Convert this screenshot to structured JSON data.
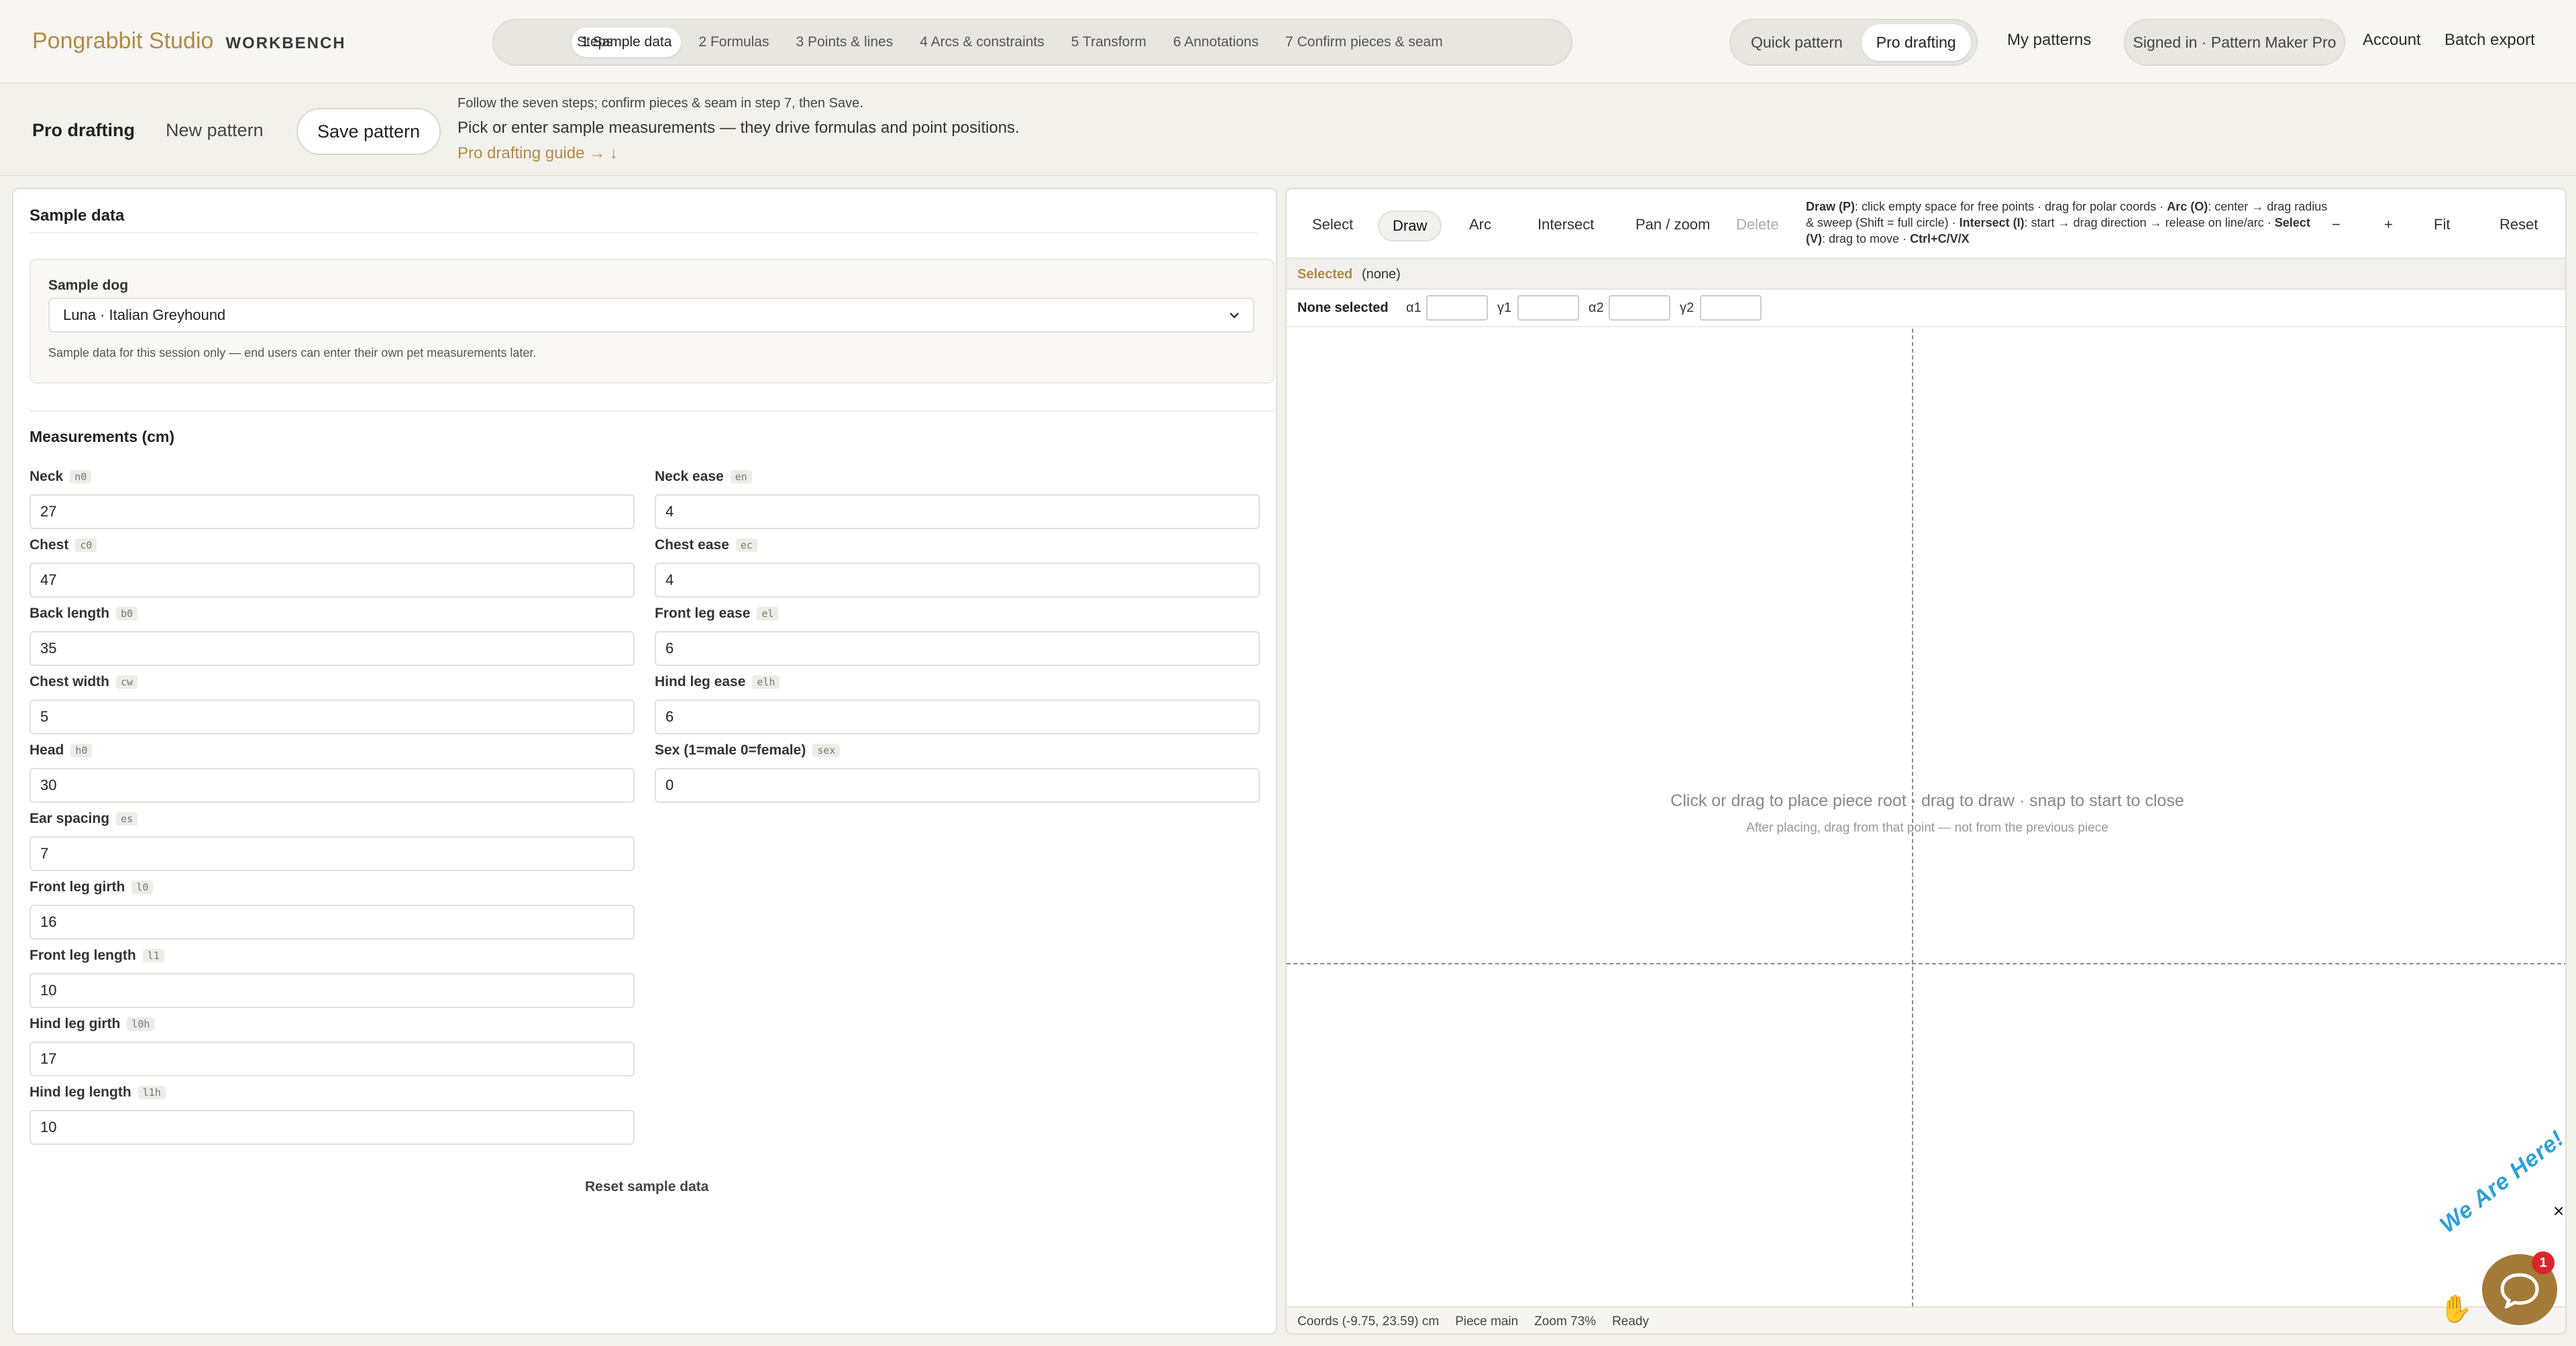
{
  "brand": {
    "name": "Pongrabbit Studio",
    "subtitle": "WORKBENCH"
  },
  "steps": {
    "label": "Steps",
    "items": [
      {
        "label": "1 Sample data",
        "active": true
      },
      {
        "label": "2 Formulas"
      },
      {
        "label": "3 Points & lines"
      },
      {
        "label": "4 Arcs & constraints"
      },
      {
        "label": "5 Transform"
      },
      {
        "label": "6 Annotations"
      },
      {
        "label": "7 Confirm pieces & seam"
      }
    ]
  },
  "mode": {
    "quick": "Quick pattern",
    "pro": "Pro drafting"
  },
  "top_links": {
    "my_patterns": "My patterns",
    "signed_in": "Signed in · Pattern Maker Pro",
    "account": "Account",
    "batch_export": "Batch export"
  },
  "subbar": {
    "pro_drafting": "Pro drafting",
    "new_pattern": "New pattern",
    "save_pattern": "Save pattern",
    "hint_line1": "Follow the seven steps; confirm pieces & seam in step 7, then Save.",
    "hint_line2": "Pick or enter sample measurements — they drive formulas and point positions.",
    "guide_link": "Pro drafting guide → ↓"
  },
  "sample_panel": {
    "title": "Sample data",
    "dog_label": "Sample dog",
    "dog_value": "Luna · Italian Greyhound",
    "dog_note": "Sample data for this session only — end users can enter their own pet measurements later.",
    "measurements_title": "Measurements (cm)",
    "left_fields": [
      {
        "label": "Neck",
        "abbr": "n0",
        "value": "27"
      },
      {
        "label": "Chest",
        "abbr": "c0",
        "value": "47"
      },
      {
        "label": "Back length",
        "abbr": "b0",
        "value": "35"
      },
      {
        "label": "Chest width",
        "abbr": "cw",
        "value": "5"
      },
      {
        "label": "Head",
        "abbr": "h0",
        "value": "30"
      },
      {
        "label": "Ear spacing",
        "abbr": "es",
        "value": "7"
      },
      {
        "label": "Front leg girth",
        "abbr": "l0",
        "value": "16"
      },
      {
        "label": "Front leg length",
        "abbr": "l1",
        "value": "10"
      },
      {
        "label": "Hind leg girth",
        "abbr": "l0h",
        "value": "17"
      },
      {
        "label": "Hind leg length",
        "abbr": "l1h",
        "value": "10"
      }
    ],
    "right_fields": [
      {
        "label": "Neck ease",
        "abbr": "en",
        "value": "4"
      },
      {
        "label": "Chest ease",
        "abbr": "ec",
        "value": "4"
      },
      {
        "label": "Front leg ease",
        "abbr": "el",
        "value": "6"
      },
      {
        "label": "Hind leg ease",
        "abbr": "elh",
        "value": "6"
      },
      {
        "label": "Sex (1=male 0=female)",
        "abbr": "sex",
        "value": "0"
      }
    ],
    "reset": "Reset sample data"
  },
  "tools": {
    "select": "Select",
    "draw": "Draw",
    "arc": "Arc",
    "intersect": "Intersect",
    "pan_zoom": "Pan / zoom",
    "delete": "Delete",
    "zoom_out": "−",
    "zoom_in": "+",
    "fit": "Fit",
    "reset": "Reset",
    "help": {
      "draw_key": "Draw (P)",
      "draw_text": ": click empty space for free points · drag for polar coords · ",
      "arc_key": "Arc (O)",
      "arc_text": ": center → drag radius & sweep (Shift = full circle) · ",
      "intersect_key": "Intersect (I)",
      "intersect_text": ": start → drag direction → release on line/arc · ",
      "select_key": "Select (V)",
      "select_text": ": drag to move · ",
      "copy_key": "Ctrl+C/V/X"
    }
  },
  "selection": {
    "label": "Selected",
    "value": "(none)",
    "none_selected": "None selected",
    "a1": "α1",
    "g1": "γ1",
    "a2": "α2",
    "g2": "γ2"
  },
  "canvas": {
    "hint": "Click or drag to place piece root  ·  drag to draw  ·  snap to start to close",
    "sub_hint": "After placing, drag from that point — not from the previous piece"
  },
  "status": {
    "coords": "Coords (-9.75, 23.59) cm",
    "piece": "Piece main",
    "zoom": "Zoom 73%",
    "state": "Ready"
  },
  "chat": {
    "text": "We Are Here!",
    "badge": "1",
    "close": "×"
  },
  "colors": {
    "accent": "#b08a4a",
    "background": "#f3f1ec",
    "badge": "#d9262c",
    "chat_text": "#2f9fd8"
  }
}
